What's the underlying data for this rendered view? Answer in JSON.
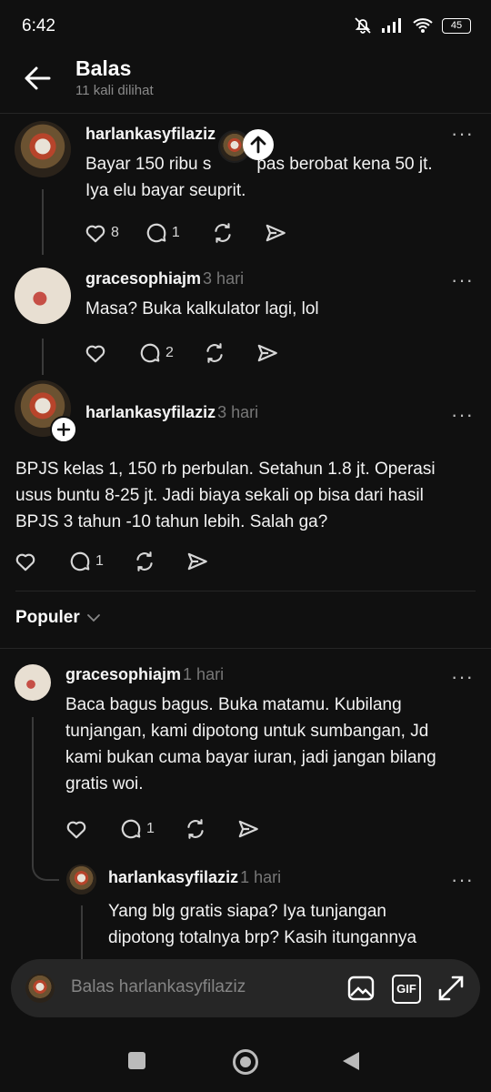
{
  "status": {
    "time": "6:42",
    "battery": "45",
    "icons": [
      "silent-mode-icon",
      "signal-icon",
      "wifi-icon",
      "battery-icon"
    ]
  },
  "header": {
    "title": "Balas",
    "views": "11 kali dilihat",
    "back_icon": "arrow-left-icon"
  },
  "thread": [
    {
      "user": "harlankasyfilaziz",
      "text": "Bayar 150 ribu sebulan pas berobat kena 50 jt. Iya elu bayar seuprit.",
      "text_line1_left": "Bayar 150 ribu s",
      "text_line1_right": "pas berobat kena 50 jt.",
      "text_line2": "Iya elu bayar seuprit.",
      "likes": "8",
      "replies": "1"
    },
    {
      "user": "gracesophiajm",
      "time": "3 hari",
      "text": "Masa? Buka kalkulator lagi, lol",
      "replies": "2"
    },
    {
      "user": "harlankasyfilaziz",
      "time": "3 hari",
      "text": "BPJS kelas 1, 150 rb perbulan. Setahun 1.8 jt. Operasi usus buntu 8-25 jt. Jadi biaya sekali op bisa dari hasil BPJS 3 tahun -10 tahun lebih. Salah ga?",
      "lines": [
        "BPJS kelas 1, 150 rb perbulan. Setahun 1.8 jt. Operasi",
        "usus buntu 8-25 jt. Jadi biaya sekali op bisa dari hasil",
        "BPJS 3 tahun -10 tahun lebih. Salah ga?"
      ],
      "replies": "1"
    }
  ],
  "sort": {
    "label": "Populer",
    "icon": "chevron-down-icon"
  },
  "replies": [
    {
      "user": "gracesophiajm",
      "time": "1 hari",
      "lines": [
        "Baca bagus bagus. Buka matamu. Kubilang",
        "tunjangan, kami dipotong untuk sumbangan, Jd",
        "kami bukan cuma bayar iuran, jadi jangan bilang",
        "gratis woi."
      ],
      "replies": "1"
    },
    {
      "user": "harlankasyfilaziz",
      "time": "1 hari",
      "lines": [
        "Yang blg gratis siapa? Iya tunjangan",
        "dipotong totalnya brp? Kasih itungannya"
      ]
    }
  ],
  "composer": {
    "placeholder": "Balas harlankasyfilaziz",
    "gif_label": "GIF",
    "icons": [
      "image-icon",
      "gif-icon",
      "expand-icon"
    ]
  },
  "nav": {
    "icons": [
      "recents-icon",
      "home-icon",
      "back-triangle-icon"
    ]
  }
}
